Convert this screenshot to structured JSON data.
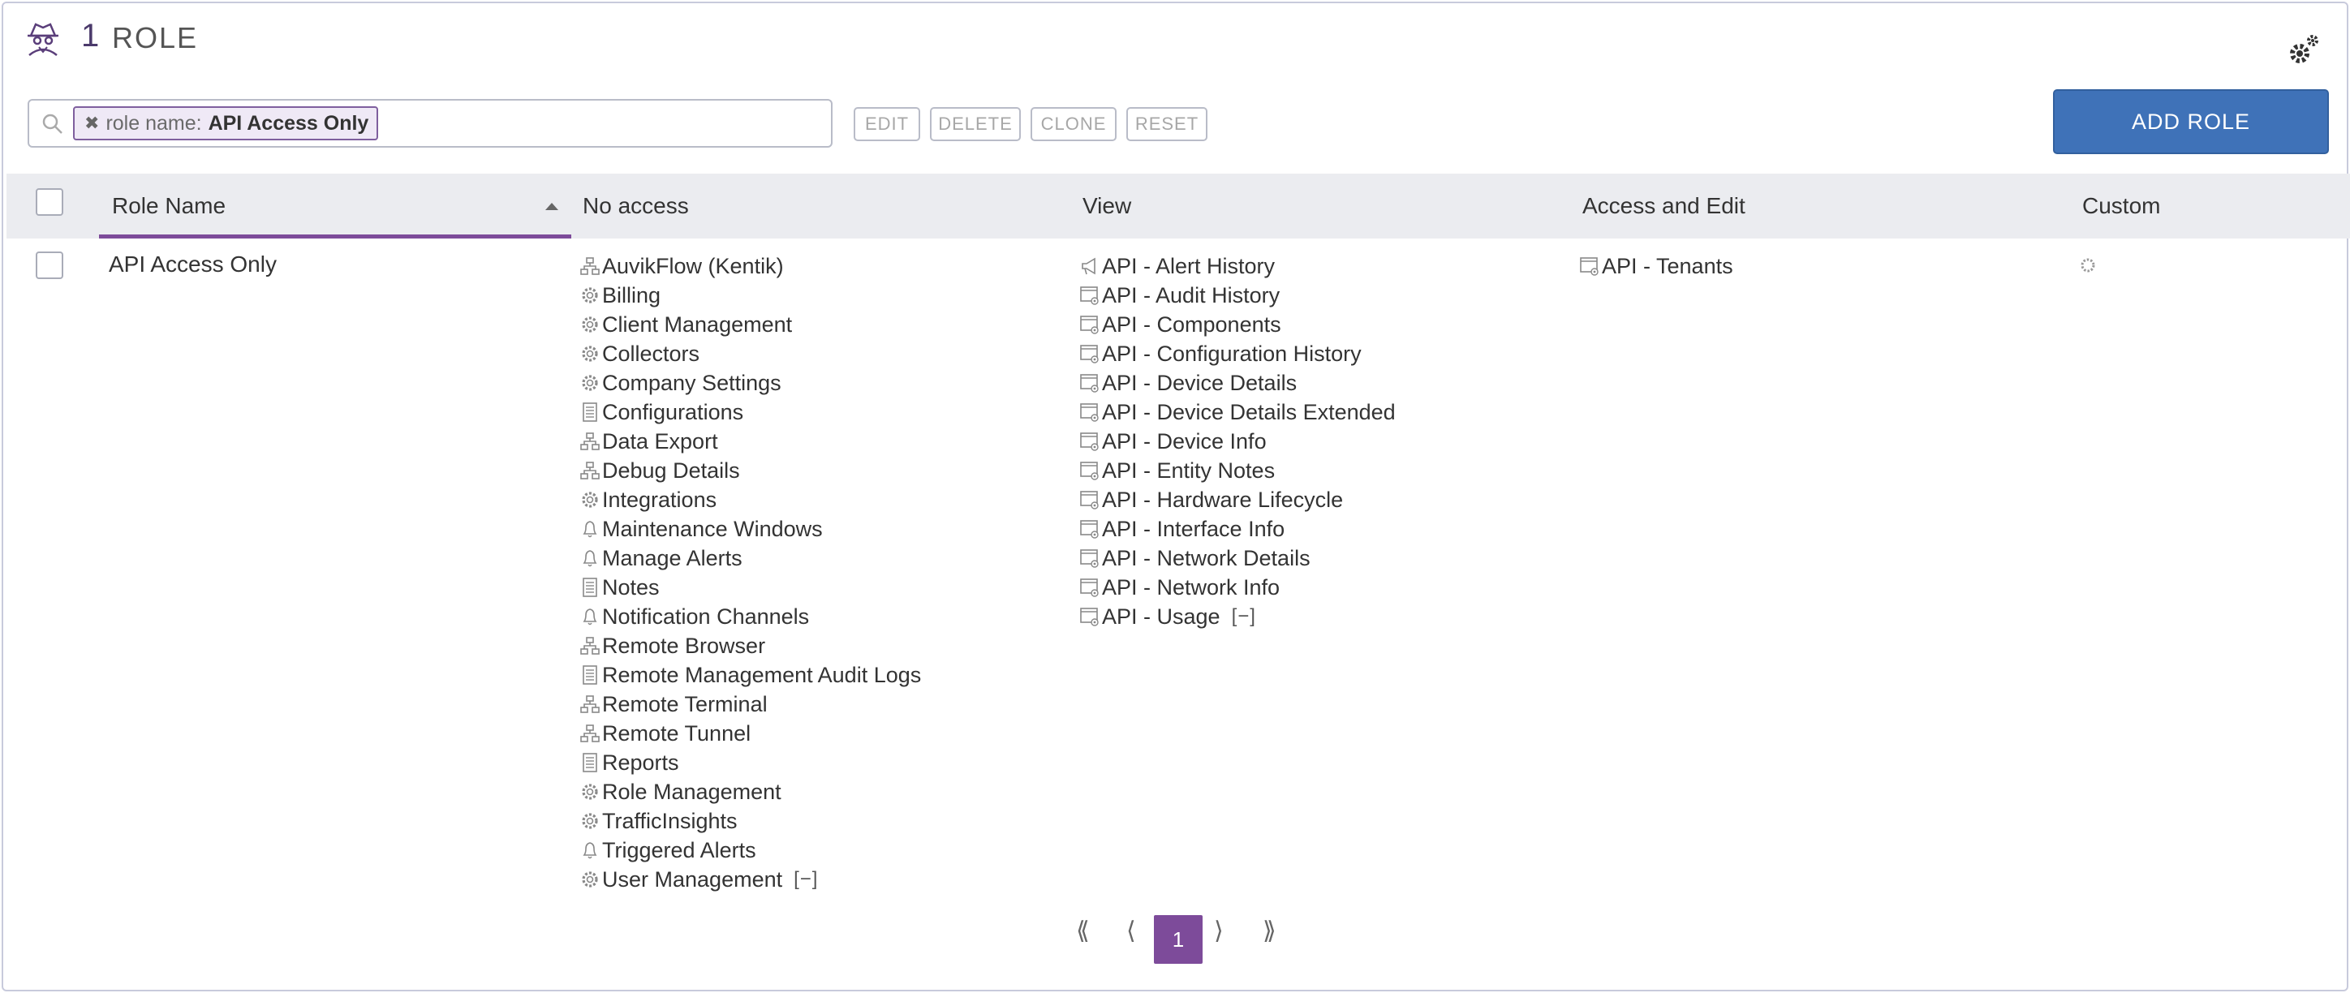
{
  "header": {
    "count": "1",
    "title": "ROLE"
  },
  "search": {
    "chip_prefix": "role name:",
    "chip_value": "API Access Only"
  },
  "toolbar": {
    "edit_label": "EDIT",
    "delete_label": "DELETE",
    "clone_label": "CLONE",
    "reset_label": "RESET",
    "add_label": "ADD ROLE"
  },
  "table": {
    "columns": [
      "Role Name",
      "No access",
      "View",
      "Access and Edit",
      "Custom"
    ],
    "rows": [
      {
        "role_name": "API Access Only",
        "no_access": [
          {
            "label": "AuvikFlow (Kentik)",
            "icon": "network-icon"
          },
          {
            "label": "Billing",
            "icon": "gear-icon"
          },
          {
            "label": "Client Management",
            "icon": "gear-icon"
          },
          {
            "label": "Collectors",
            "icon": "gear-icon"
          },
          {
            "label": "Company Settings",
            "icon": "gear-icon"
          },
          {
            "label": "Configurations",
            "icon": "document-icon"
          },
          {
            "label": "Data Export",
            "icon": "network-icon"
          },
          {
            "label": "Debug Details",
            "icon": "network-icon"
          },
          {
            "label": "Integrations",
            "icon": "gear-icon"
          },
          {
            "label": "Maintenance Windows",
            "icon": "bell-icon"
          },
          {
            "label": "Manage Alerts",
            "icon": "bell-icon"
          },
          {
            "label": "Notes",
            "icon": "document-icon"
          },
          {
            "label": "Notification Channels",
            "icon": "bell-icon"
          },
          {
            "label": "Remote Browser",
            "icon": "network-icon"
          },
          {
            "label": "Remote Management Audit Logs",
            "icon": "document-icon"
          },
          {
            "label": "Remote Terminal",
            "icon": "network-icon"
          },
          {
            "label": "Remote Tunnel",
            "icon": "network-icon"
          },
          {
            "label": "Reports",
            "icon": "document-icon"
          },
          {
            "label": "Role Management",
            "icon": "gear-icon"
          },
          {
            "label": "TrafficInsights",
            "icon": "gear-icon"
          },
          {
            "label": "Triggered Alerts",
            "icon": "bell-icon"
          },
          {
            "label": "User Management",
            "icon": "gear-icon"
          }
        ],
        "view": [
          {
            "label": "API - Alert History",
            "icon": "megaphone-icon"
          },
          {
            "label": "API - Audit History",
            "icon": "api-window-icon"
          },
          {
            "label": "API - Components",
            "icon": "api-window-icon"
          },
          {
            "label": "API - Configuration History",
            "icon": "api-window-icon"
          },
          {
            "label": "API - Device Details",
            "icon": "api-window-icon"
          },
          {
            "label": "API - Device Details Extended",
            "icon": "api-window-icon"
          },
          {
            "label": "API - Device Info",
            "icon": "api-window-icon"
          },
          {
            "label": "API - Entity Notes",
            "icon": "api-window-icon"
          },
          {
            "label": "API - Hardware Lifecycle",
            "icon": "api-window-icon"
          },
          {
            "label": "API - Interface Info",
            "icon": "api-window-icon"
          },
          {
            "label": "API - Network Details",
            "icon": "api-window-icon"
          },
          {
            "label": "API - Network Info",
            "icon": "api-window-icon"
          },
          {
            "label": "API - Usage",
            "icon": "api-window-icon"
          }
        ],
        "access_edit": [
          {
            "label": "API - Tenants",
            "icon": "api-window-icon"
          }
        ],
        "custom_icon": "gear-icon"
      }
    ],
    "collapse_label": "[−]"
  },
  "pagination": {
    "first": "⟪",
    "prev": "⟨",
    "current": "1",
    "next": "⟩",
    "last": "⟫"
  },
  "colors": {
    "accent_purple": "#7d4b9a",
    "primary_blue": "#3f72b8",
    "header_bg": "#ebecf0"
  }
}
